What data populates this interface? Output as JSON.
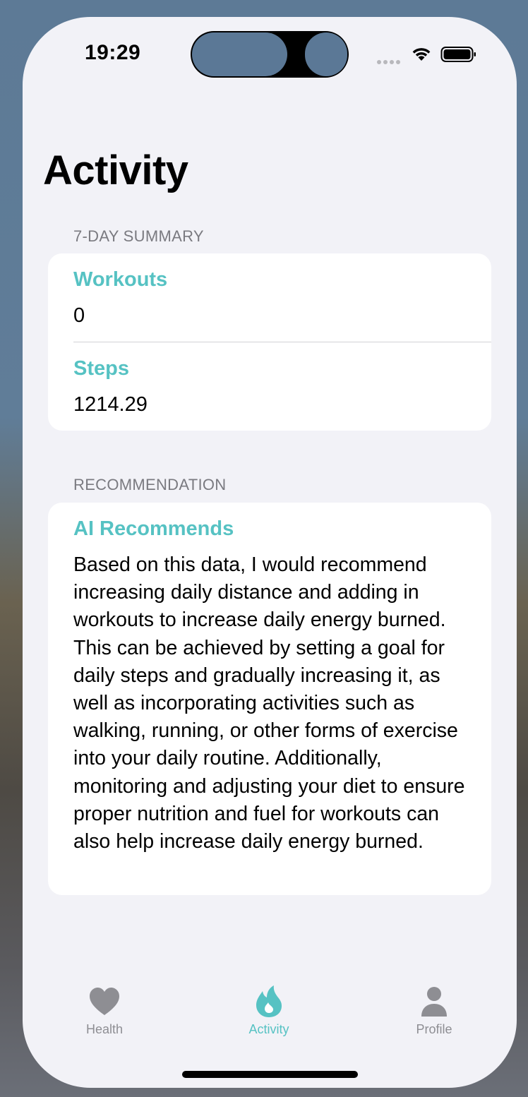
{
  "status_bar": {
    "time": "19:29"
  },
  "page": {
    "title": "Activity"
  },
  "summary_section": {
    "header": "7-DAY SUMMARY",
    "rows": [
      {
        "label": "Workouts",
        "value": "0"
      },
      {
        "label": "Steps",
        "value": "1214.29"
      }
    ]
  },
  "recommendation_section": {
    "header": "RECOMMENDATION",
    "title": "AI Recommends",
    "body": "Based on this data, I would recommend increasing daily distance and adding in workouts to increase daily energy burned. This can be achieved by setting a goal for daily steps and gradually increasing it, as well as incorporating activities such as walking, running, or other forms of exercise into your daily routine. Additionally, monitoring and adjusting your diet to ensure proper nutrition and fuel for workouts can also help increase daily energy burned."
  },
  "tab_bar": {
    "tabs": [
      {
        "label": "Health",
        "icon": "heart-icon",
        "selected": false
      },
      {
        "label": "Activity",
        "icon": "flame-icon",
        "selected": true
      },
      {
        "label": "Profile",
        "icon": "person-icon",
        "selected": false
      }
    ]
  },
  "colors": {
    "accent": "#56c2c3",
    "inactive_tab": "#8e8e93",
    "background": "#f2f2f7",
    "card": "#ffffff"
  }
}
